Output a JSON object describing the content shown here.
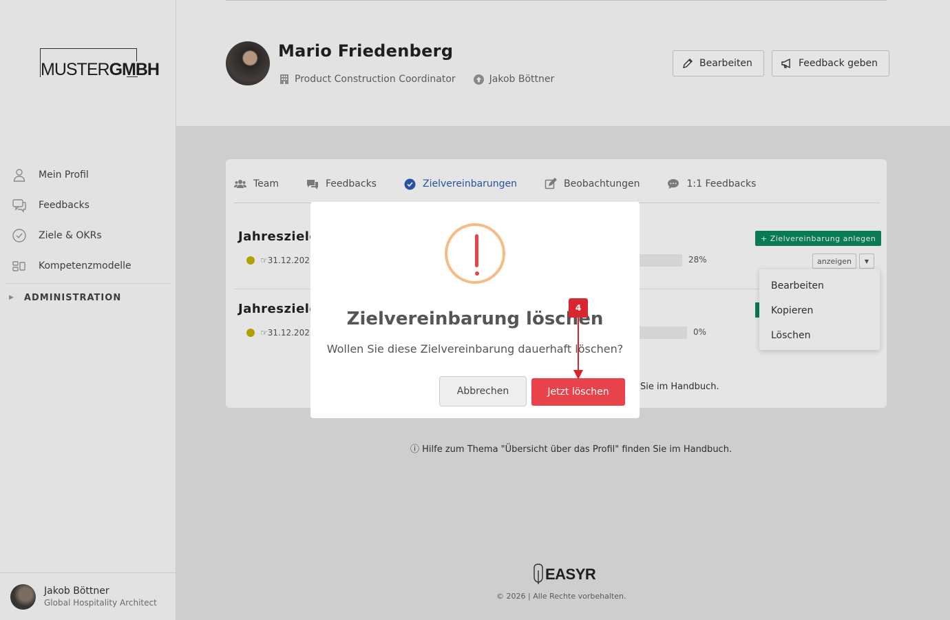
{
  "sidebar": {
    "logo": {
      "part1": "MUSTER",
      "part2": "GMBH"
    },
    "items": [
      {
        "label": "Mein Profil",
        "icon": "user-icon"
      },
      {
        "label": "Feedbacks",
        "icon": "chat-icon"
      },
      {
        "label": "Ziele & OKRs",
        "icon": "check-circle-icon"
      },
      {
        "label": "Kompetenzmodelle",
        "icon": "competence-icon"
      }
    ],
    "admin_label": "ADMINISTRATION",
    "user": {
      "name": "Jakob Böttner",
      "role": "Global Hospitality Architect"
    }
  },
  "profile": {
    "name": "Mario Friedenberg",
    "position": "Product Construction Coordinator",
    "manager": "Jakob Böttner",
    "edit_label": "Bearbeiten",
    "feedback_label": "Feedback geben"
  },
  "tabs": [
    {
      "label": "Team"
    },
    {
      "label": "Feedbacks"
    },
    {
      "label": "Zielvereinbarungen"
    },
    {
      "label": "Beobachtungen"
    },
    {
      "label": "1:1 Feedbacks"
    }
  ],
  "goals": [
    {
      "title": "Jahresziele",
      "date": "31.12.202",
      "percent": "28%",
      "progress": 0.28
    },
    {
      "title": "Jahresziele",
      "date": "31.12.202",
      "percent": "0%",
      "progress": 0
    }
  ],
  "actions": {
    "new_agreement": "+ Zielvereinbarung anlegen",
    "show": "anzeigen",
    "menu": [
      "Bearbeiten",
      "Kopieren",
      "Löschen"
    ]
  },
  "card_help": "Sie im Handbuch.",
  "page_help": "Hilfe zum Thema \"Übersicht über das Profil\" finden Sie im Handbuch.",
  "footer": {
    "brand": "EASYR",
    "copyright": "© 2026 | Alle Rechte vorbehalten."
  },
  "modal": {
    "title": "Zielvereinbarung löschen",
    "text": "Wollen Sie diese Zielvereinbarung dauerhaft löschen?",
    "cancel": "Abbrechen",
    "confirm": "Jetzt löschen"
  },
  "step": {
    "number": "4"
  },
  "colors": {
    "accent": "#2a5db0",
    "danger": "#e8434a",
    "success": "#0a8a5c",
    "warning_ring": "#f8bb86"
  }
}
